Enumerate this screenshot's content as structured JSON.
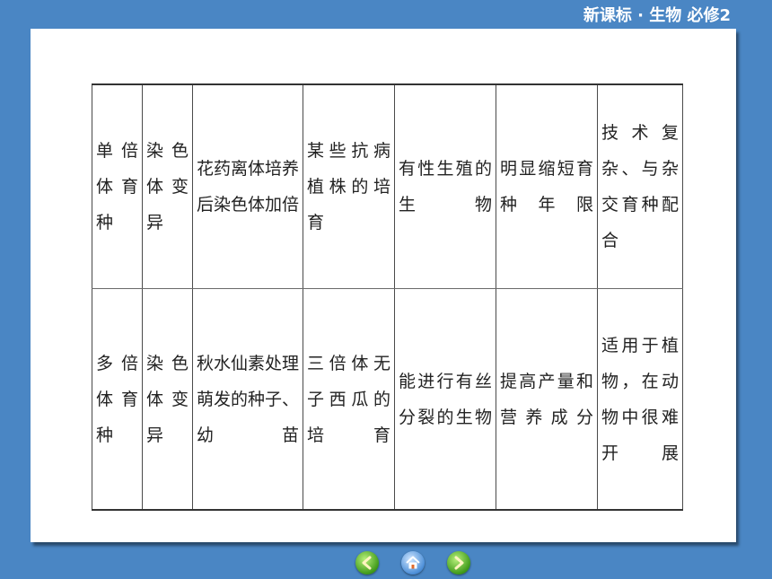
{
  "header": {
    "title": "新课标 · 生物    必修2"
  },
  "table": {
    "rows": [
      [
        "单倍体育种",
        "染色体变异",
        "花药离体培养后染色体加倍",
        "某些抗病植株的培育",
        "有性生殖的生物",
        "明显缩短育种年限",
        "技术复杂、与杂交育种配合"
      ],
      [
        "多倍体育种",
        "染色体变异",
        "秋水仙素处理萌发的种子、幼苗",
        "三倍体无子西瓜的培育",
        "能进行有丝分裂的生物",
        "提高产量和营养成分",
        "适用于植物，在动物中很难开展"
      ]
    ]
  },
  "navigation": {
    "prev_icon": "back-arrow-icon",
    "home_icon": "home-icon",
    "next_icon": "forward-arrow-icon"
  }
}
